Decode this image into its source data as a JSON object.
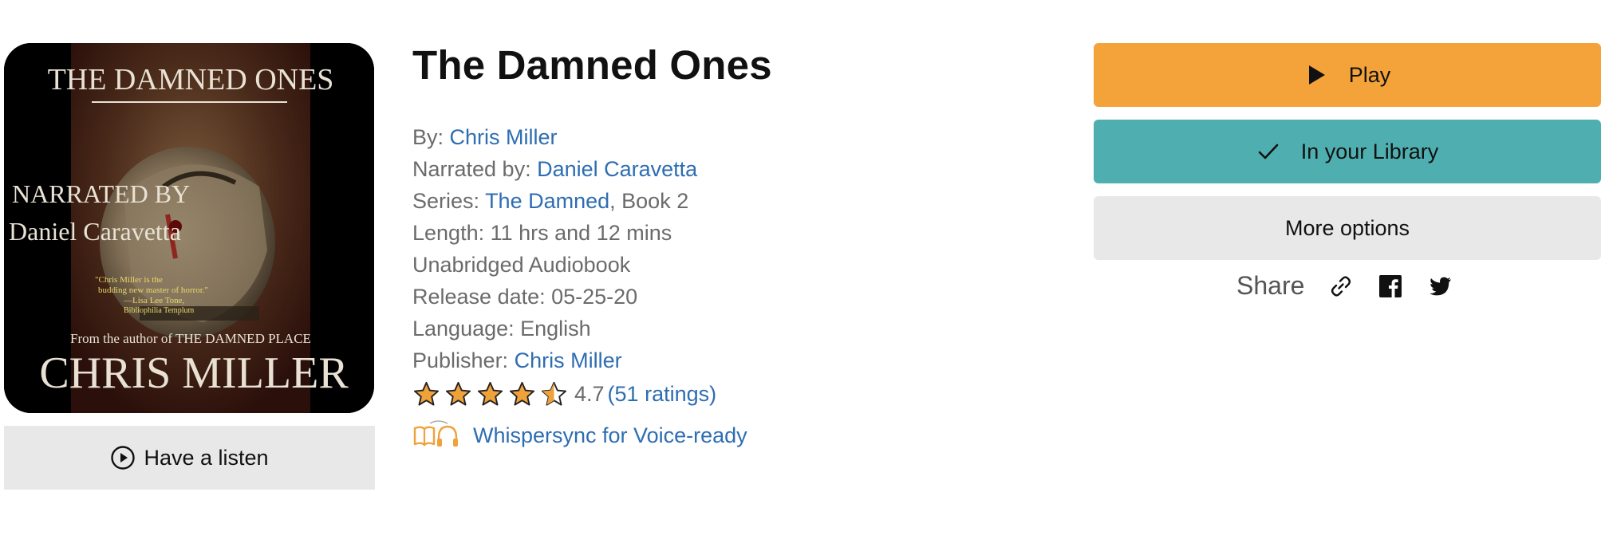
{
  "cover": {
    "title_text": "THE DAMNED ONES",
    "narrated_line1": "NARRATED BY",
    "narrated_line2": "Daniel Caravetta",
    "quote_line1": "\"Chris Miller is the",
    "quote_line2": "budding new master of horror.\"",
    "quote_line3": "—Lisa Lee Tone,",
    "quote_line4": "Bibliophilia Templum",
    "author_line_small": "From the author of THE DAMNED PLACE",
    "author_big": "CHRIS MILLER"
  },
  "listen": {
    "label": "Have a listen",
    "icon": "play-circle-icon"
  },
  "book": {
    "title": "The Damned Ones",
    "by_label": "By:",
    "author": "Chris Miller",
    "narrated_label": "Narrated by:",
    "narrator": "Daniel Caravetta",
    "series_label": "Series:",
    "series": "The Damned",
    "series_suffix": ", Book 2",
    "length": "Length: 11 hrs and 12 mins",
    "format": "Unabridged Audiobook",
    "release": "Release date: 05-25-20",
    "language": "Language: English",
    "publisher_label": "Publisher:",
    "publisher": "Chris Miller",
    "rating_value": "4.7",
    "rating_count": "(51 ratings)",
    "stars": 4.7,
    "whispersync": "Whispersync for Voice-ready"
  },
  "actions": {
    "play": "Play",
    "library": "In your Library",
    "more": "More options",
    "share": "Share"
  },
  "colors": {
    "play": "#f3a33a",
    "library": "#4fafb0",
    "link": "#2d6db2",
    "star": "#f0a23a"
  }
}
